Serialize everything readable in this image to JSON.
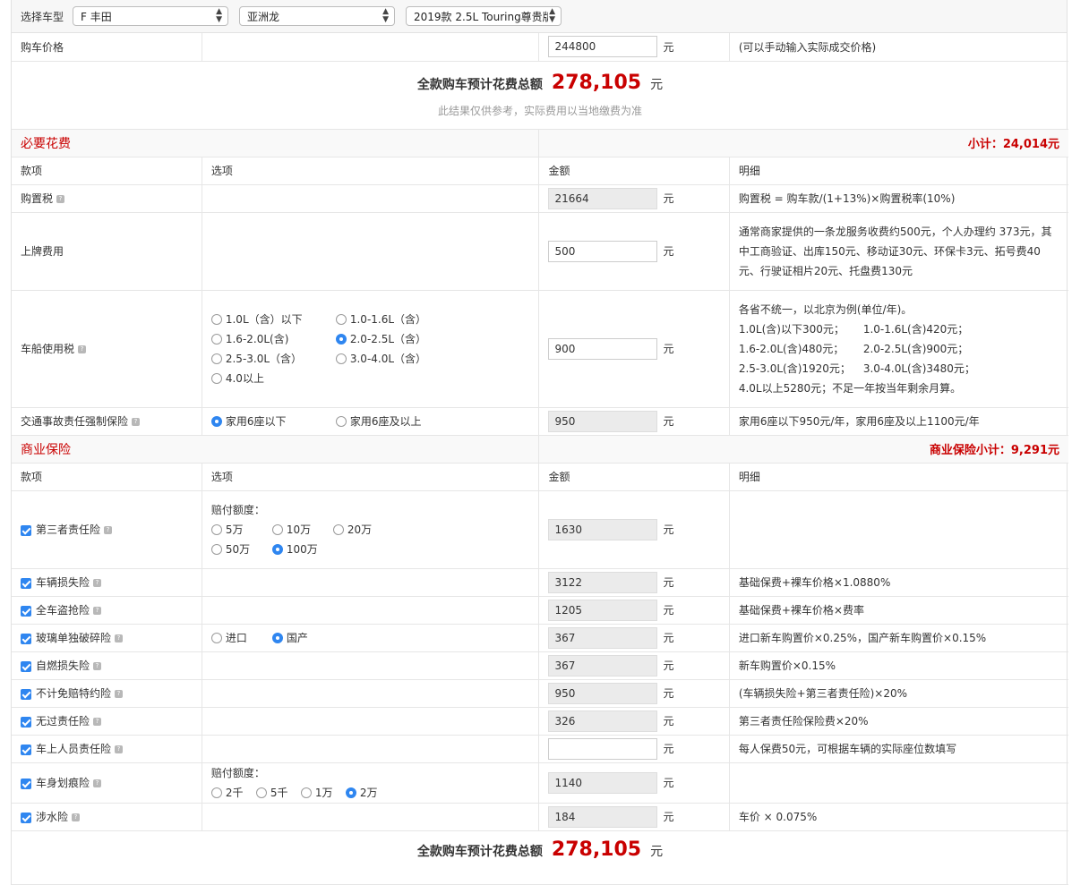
{
  "selector": {
    "label": "选择车型",
    "brand": "F 丰田",
    "series": "亚洲龙",
    "model": "2019款 2.5L Touring尊贵版 |"
  },
  "price": {
    "label": "购车价格",
    "value": "244800",
    "unit": "元",
    "note": "(可以手动输入实际成交价格)"
  },
  "summary": {
    "label": "全款购车预计花费总额",
    "amount": "278,105",
    "unit": "元",
    "note": "此结果仅供参考，实际费用以当地缴费为准"
  },
  "required": {
    "title": "必要花费",
    "subtotal": "小计：24,014元",
    "headers": [
      "款项",
      "选项",
      "金额",
      "明细"
    ],
    "purchase_tax": {
      "name": "购置税",
      "value": "21664",
      "unit": "元",
      "detail": "购置税 = 购车款/(1+13%)×购置税率(10%)"
    },
    "plate_fee": {
      "name": "上牌费用",
      "value": "500",
      "unit": "元",
      "detail": "通常商家提供的一条龙服务收费约500元，个人办理约 373元，其中工商验证、出库150元、移动证30元、环保卡3元、拓号费40元、行驶证相片20元、托盘费130元"
    },
    "vehicle_tax": {
      "name": "车船使用税",
      "options": [
        "1.0L（含）以下",
        "1.0-1.6L（含）",
        "1.6-2.0L(含)",
        "2.0-2.5L（含）",
        "2.5-3.0L（含）",
        "3.0-4.0L（含）",
        "4.0以上"
      ],
      "selected": 3,
      "value": "900",
      "unit": "元",
      "detail_lines": [
        "各省不统一，以北京为例(单位/年)。",
        "1.0L(含)以下300元；",
        "1.0-1.6L(含)420元；",
        "1.6-2.0L(含)480元；",
        "2.0-2.5L(含)900元；",
        "2.5-3.0L(含)1920元；",
        "3.0-4.0L(含)3480元；",
        "4.0L以上5280元；不足一年按当年剩余月算。"
      ]
    },
    "compulsory": {
      "name": "交通事故责任强制保险",
      "options": [
        "家用6座以下",
        "家用6座及以上"
      ],
      "selected": 0,
      "value": "950",
      "unit": "元",
      "detail": "家用6座以下950元/年，家用6座及以上1100元/年"
    }
  },
  "commercial": {
    "title": "商业保险",
    "subtotal": "商业保险小计：9,291元",
    "headers": [
      "款项",
      "选项",
      "金额",
      "明细"
    ],
    "third_party": {
      "name": "第三者责任险",
      "label": "赔付额度：",
      "options": [
        "5万",
        "10万",
        "20万",
        "50万",
        "100万"
      ],
      "selected": 4,
      "value": "1630",
      "unit": "元",
      "detail": ""
    },
    "damage": {
      "name": "车辆损失险",
      "value": "3122",
      "unit": "元",
      "detail": "基础保费+裸车价格×1.0880%"
    },
    "theft": {
      "name": "全车盗抢险",
      "value": "1205",
      "unit": "元",
      "detail": "基础保费+裸车价格×费率"
    },
    "glass": {
      "name": "玻璃单独破碎险",
      "options": [
        "进口",
        "国产"
      ],
      "selected": 1,
      "value": "367",
      "unit": "元",
      "detail": "进口新车购置价×0.25%，国产新车购置价×0.15%"
    },
    "fire": {
      "name": "自燃损失险",
      "value": "367",
      "unit": "元",
      "detail": "新车购置价×0.15%"
    },
    "deductible": {
      "name": "不计免赔特约险",
      "value": "950",
      "unit": "元",
      "detail": "(车辆损失险+第三者责任险)×20%"
    },
    "no_fault": {
      "name": "无过责任险",
      "value": "326",
      "unit": "元",
      "detail": "第三者责任险保险费×20%"
    },
    "passenger": {
      "name": "车上人员责任险",
      "value": "",
      "unit": "元",
      "detail": "每人保费50元，可根据车辆的实际座位数填写"
    },
    "scratch": {
      "name": "车身划痕险",
      "label": "赔付额度：",
      "options": [
        "2千",
        "5千",
        "1万",
        "2万"
      ],
      "selected": 3,
      "value": "1140",
      "unit": "元",
      "detail": ""
    },
    "water": {
      "name": "涉水险",
      "value": "184",
      "unit": "元",
      "detail": "车价 × 0.075%"
    }
  },
  "footer_summary": {
    "label": "全款购车预计花费总额",
    "amount": "278,105",
    "unit": "元"
  }
}
